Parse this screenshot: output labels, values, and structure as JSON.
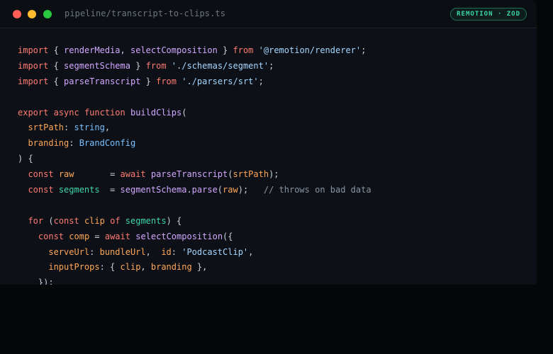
{
  "window": {
    "file_path": "pipeline/transcript-to-clips.ts",
    "badge": "REMOTION · ZOD"
  },
  "colors": {
    "keyword": "#ff7b72",
    "function": "#d2a8ff",
    "string": "#a5d6ff",
    "property": "#ffa657",
    "type": "#79c0ff",
    "comment": "#8b949e",
    "accent": "#3fd6a8"
  },
  "code_lines": [
    [
      [
        "kw",
        "import"
      ],
      [
        "p",
        " { "
      ],
      [
        "id",
        "renderMedia"
      ],
      [
        "p",
        ", "
      ],
      [
        "id",
        "selectComposition"
      ],
      [
        "p",
        " } "
      ],
      [
        "kw",
        "from"
      ],
      [
        "p",
        " "
      ],
      [
        "str",
        "'@remotion/renderer'"
      ],
      [
        "p",
        ";"
      ]
    ],
    [
      [
        "kw",
        "import"
      ],
      [
        "p",
        " { "
      ],
      [
        "id",
        "segmentSchema"
      ],
      [
        "p",
        " } "
      ],
      [
        "kw",
        "from"
      ],
      [
        "p",
        " "
      ],
      [
        "str",
        "'./schemas/segment'"
      ],
      [
        "p",
        ";"
      ]
    ],
    [
      [
        "kw",
        "import"
      ],
      [
        "p",
        " { "
      ],
      [
        "id",
        "parseTranscript"
      ],
      [
        "p",
        " } "
      ],
      [
        "kw",
        "from"
      ],
      [
        "p",
        " "
      ],
      [
        "str",
        "'./parsers/srt'"
      ],
      [
        "p",
        ";"
      ]
    ],
    [],
    [
      [
        "kw",
        "export"
      ],
      [
        "p",
        " "
      ],
      [
        "kw",
        "async"
      ],
      [
        "p",
        " "
      ],
      [
        "kw",
        "function"
      ],
      [
        "p",
        " "
      ],
      [
        "id",
        "buildClips"
      ],
      [
        "p",
        "("
      ]
    ],
    [
      [
        "p",
        "  "
      ],
      [
        "prop",
        "srtPath"
      ],
      [
        "p",
        ": "
      ],
      [
        "type",
        "string"
      ],
      [
        "p",
        ","
      ]
    ],
    [
      [
        "p",
        "  "
      ],
      [
        "prop",
        "branding"
      ],
      [
        "p",
        ": "
      ],
      [
        "type",
        "BrandConfig"
      ]
    ],
    [
      [
        "p",
        ") {"
      ]
    ],
    [
      [
        "p",
        "  "
      ],
      [
        "kw",
        "const"
      ],
      [
        "p",
        " "
      ],
      [
        "prop",
        "raw"
      ],
      [
        "p",
        "       = "
      ],
      [
        "kw",
        "await"
      ],
      [
        "p",
        " "
      ],
      [
        "id",
        "parseTranscript"
      ],
      [
        "p",
        "("
      ],
      [
        "prop",
        "srtPath"
      ],
      [
        "p",
        ");"
      ]
    ],
    [
      [
        "p",
        "  "
      ],
      [
        "kw",
        "const"
      ],
      [
        "p",
        " "
      ],
      [
        "grn",
        "segments"
      ],
      [
        "p",
        "  = "
      ],
      [
        "id",
        "segmentSchema"
      ],
      [
        "p",
        "."
      ],
      [
        "id",
        "parse"
      ],
      [
        "p",
        "("
      ],
      [
        "prop",
        "raw"
      ],
      [
        "p",
        ");   "
      ],
      [
        "cm",
        "// throws on bad data"
      ]
    ],
    [],
    [
      [
        "p",
        "  "
      ],
      [
        "kw",
        "for"
      ],
      [
        "p",
        " ("
      ],
      [
        "kw",
        "const"
      ],
      [
        "p",
        " "
      ],
      [
        "prop",
        "clip"
      ],
      [
        "p",
        " "
      ],
      [
        "kw",
        "of"
      ],
      [
        "p",
        " "
      ],
      [
        "grn",
        "segments"
      ],
      [
        "p",
        ") {"
      ]
    ],
    [
      [
        "p",
        "    "
      ],
      [
        "kw",
        "const"
      ],
      [
        "p",
        " "
      ],
      [
        "prop",
        "comp"
      ],
      [
        "p",
        " = "
      ],
      [
        "kw",
        "await"
      ],
      [
        "p",
        " "
      ],
      [
        "id",
        "selectComposition"
      ],
      [
        "p",
        "({"
      ]
    ],
    [
      [
        "p",
        "      "
      ],
      [
        "prop",
        "serveUrl"
      ],
      [
        "p",
        ": "
      ],
      [
        "prop",
        "bundleUrl"
      ],
      [
        "p",
        ",  "
      ],
      [
        "prop",
        "id"
      ],
      [
        "p",
        ": "
      ],
      [
        "str",
        "'PodcastClip'"
      ],
      [
        "p",
        ","
      ]
    ],
    [
      [
        "p",
        "      "
      ],
      [
        "prop",
        "inputProps"
      ],
      [
        "p",
        ": { "
      ],
      [
        "prop",
        "clip"
      ],
      [
        "p",
        ", "
      ],
      [
        "prop",
        "branding"
      ],
      [
        "p",
        " },"
      ]
    ],
    [
      [
        "p",
        "    });"
      ]
    ]
  ]
}
